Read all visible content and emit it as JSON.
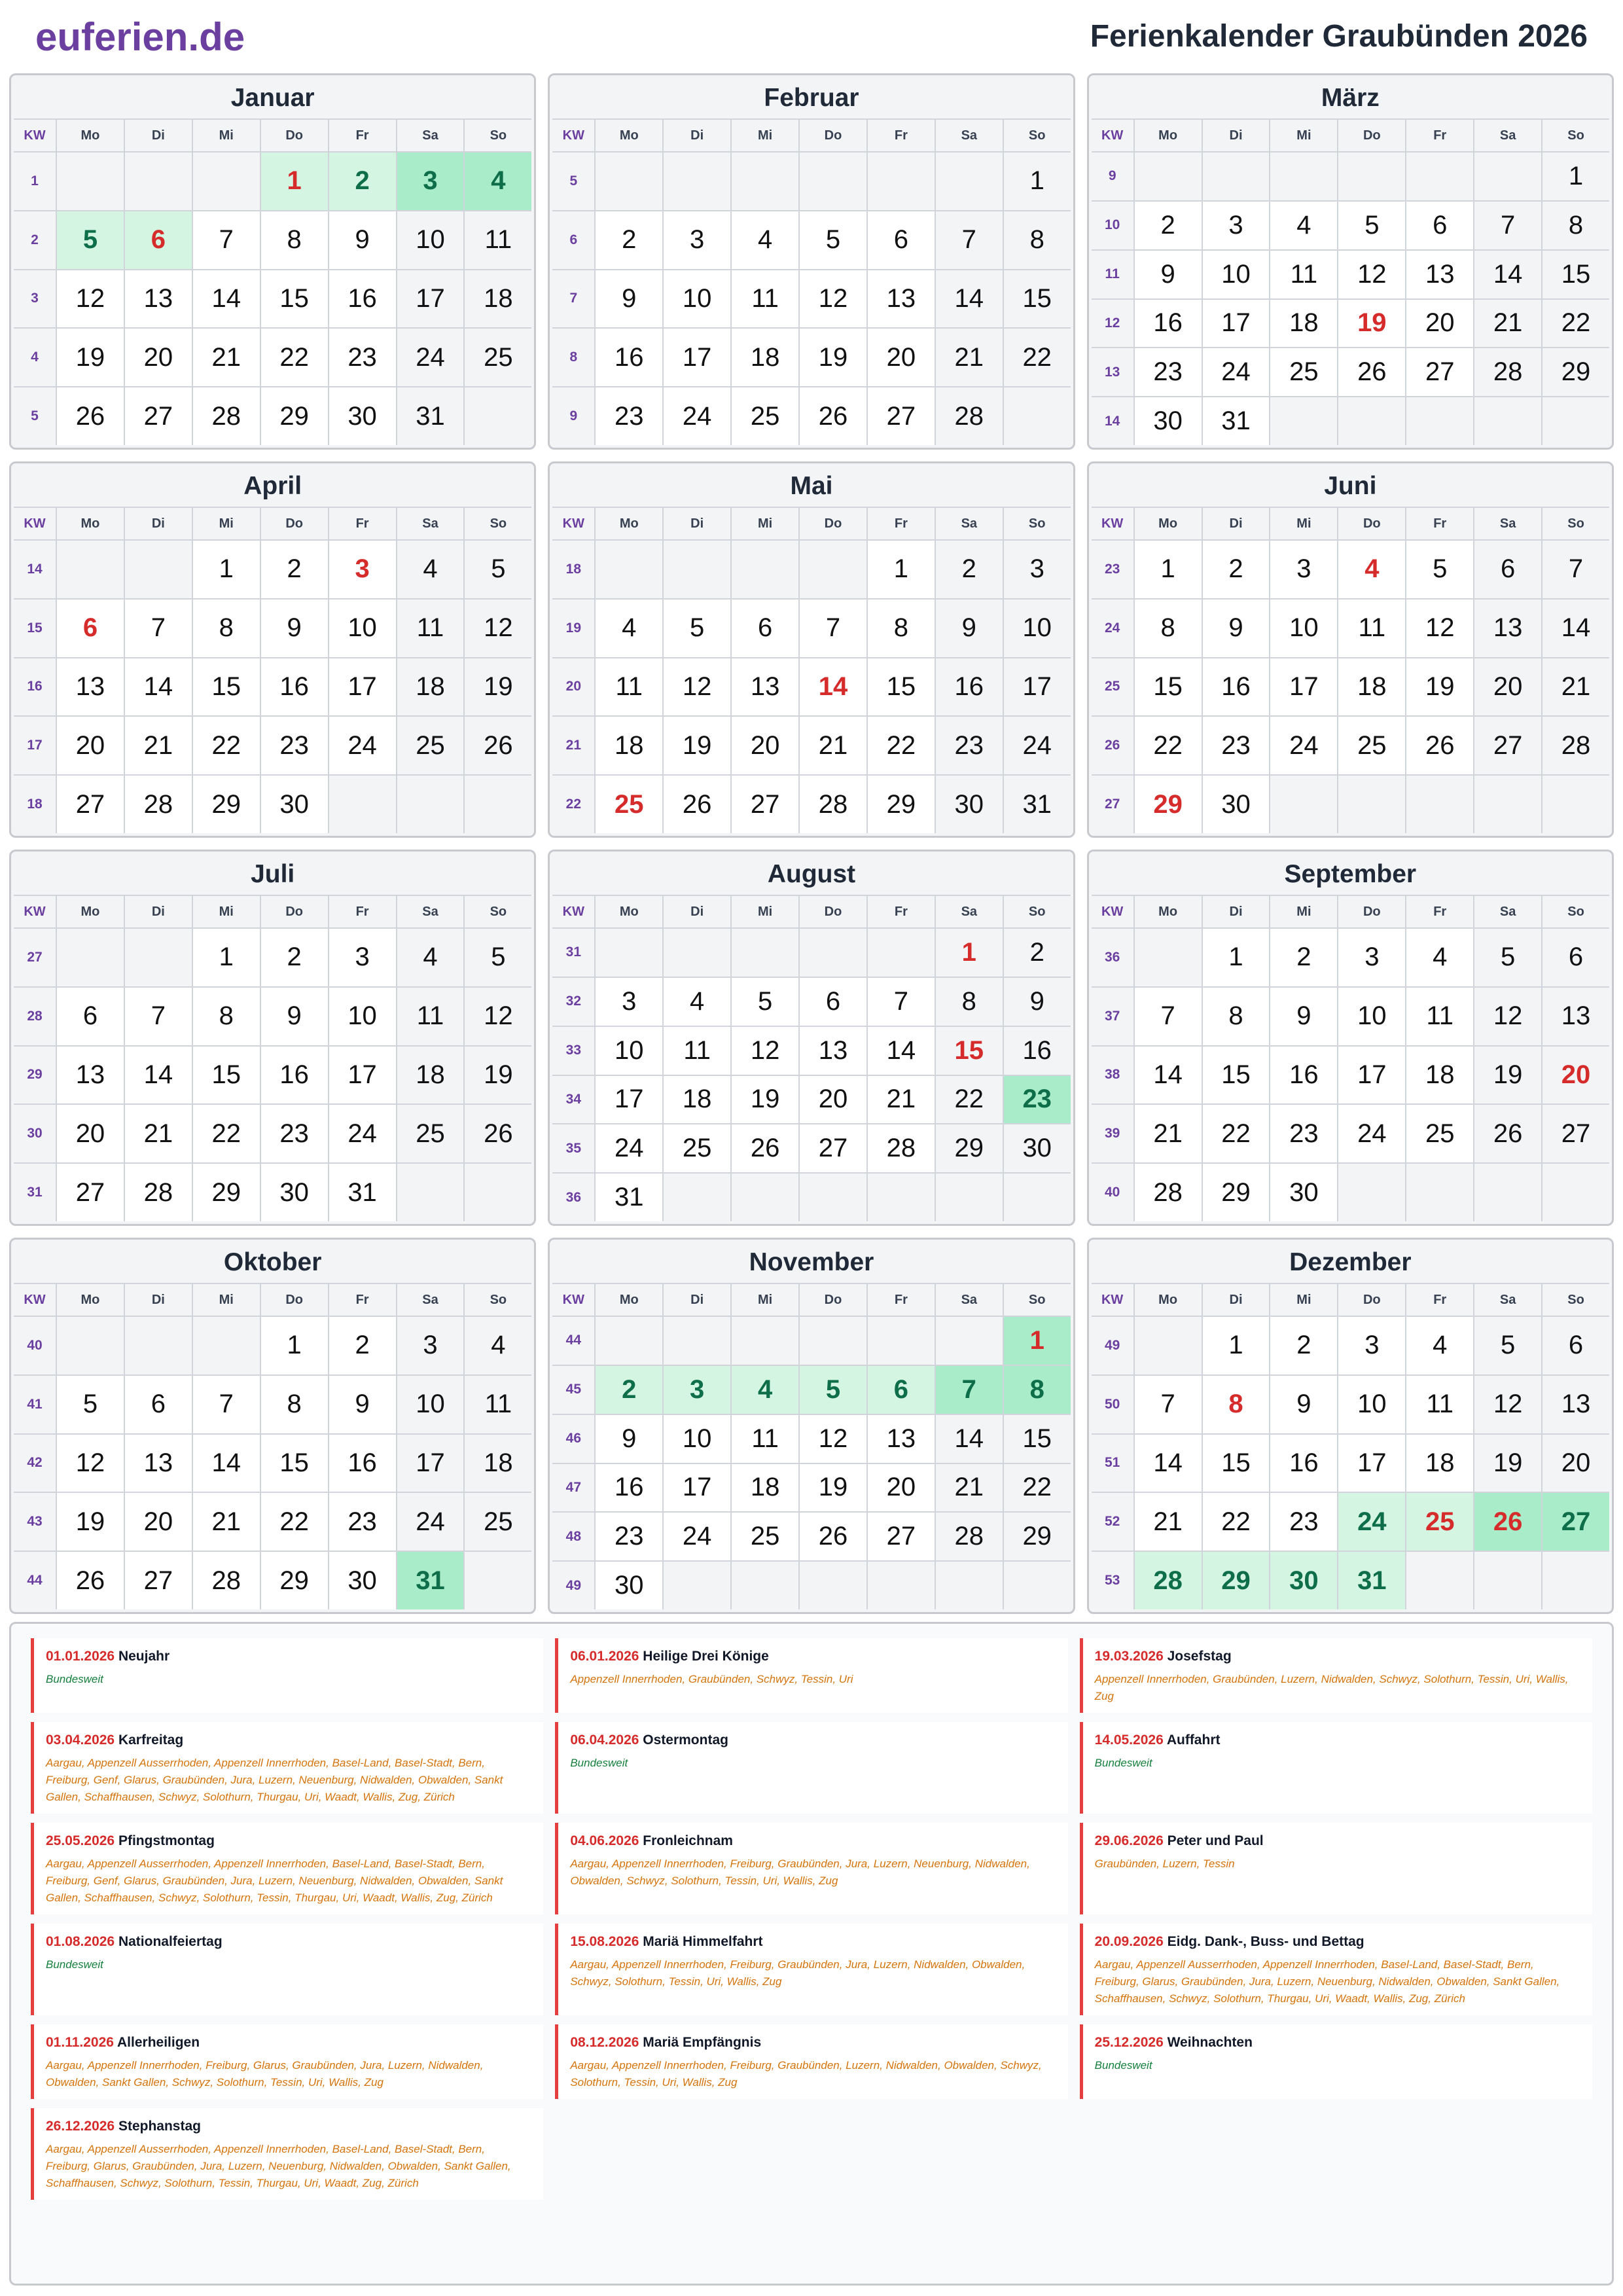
{
  "header": {
    "logo": "euferien.de",
    "title": "Ferienkalender Graubünden 2026"
  },
  "weekday_headers": [
    "KW",
    "Mo",
    "Di",
    "Mi",
    "Do",
    "Fr",
    "Sa",
    "So"
  ],
  "months": [
    {
      "name": "Januar",
      "start": 3,
      "days": 31,
      "kw": [
        "1",
        "2",
        "3",
        "4",
        "5"
      ],
      "hol": [
        1,
        6
      ],
      "vac": [
        1,
        2,
        3,
        4,
        5,
        6
      ]
    },
    {
      "name": "Februar",
      "start": 6,
      "days": 28,
      "kw": [
        "5",
        "6",
        "7",
        "8",
        "9"
      ],
      "hol": [],
      "vac": []
    },
    {
      "name": "März",
      "start": 6,
      "days": 31,
      "kw": [
        "9",
        "10",
        "11",
        "12",
        "13",
        "14"
      ],
      "hol": [
        19
      ],
      "vac": []
    },
    {
      "name": "April",
      "start": 2,
      "days": 30,
      "kw": [
        "14",
        "15",
        "16",
        "17",
        "18"
      ],
      "hol": [
        3,
        6
      ],
      "vac": []
    },
    {
      "name": "Mai",
      "start": 4,
      "days": 31,
      "kw": [
        "18",
        "19",
        "20",
        "21",
        "22"
      ],
      "hol": [
        14,
        25
      ],
      "vac": []
    },
    {
      "name": "Juni",
      "start": 0,
      "days": 30,
      "kw": [
        "23",
        "24",
        "25",
        "26",
        "27"
      ],
      "hol": [
        4,
        29
      ],
      "vac": []
    },
    {
      "name": "Juli",
      "start": 2,
      "days": 31,
      "kw": [
        "27",
        "28",
        "29",
        "30",
        "31"
      ],
      "hol": [],
      "vac": []
    },
    {
      "name": "August",
      "start": 5,
      "days": 31,
      "kw": [
        "31",
        "32",
        "33",
        "34",
        "35",
        "36"
      ],
      "hol": [
        1,
        15
      ],
      "vac": [
        23
      ]
    },
    {
      "name": "September",
      "start": 1,
      "days": 30,
      "kw": [
        "36",
        "37",
        "38",
        "39",
        "40"
      ],
      "hol": [
        20
      ],
      "vac": []
    },
    {
      "name": "Oktober",
      "start": 3,
      "days": 31,
      "kw": [
        "40",
        "41",
        "42",
        "43",
        "44"
      ],
      "hol": [],
      "vac": [
        31
      ]
    },
    {
      "name": "November",
      "start": 6,
      "days": 30,
      "kw": [
        "44",
        "45",
        "46",
        "47",
        "48",
        "49"
      ],
      "hol": [
        1
      ],
      "vac": [
        1,
        2,
        3,
        4,
        5,
        6,
        7,
        8
      ]
    },
    {
      "name": "Dezember",
      "start": 1,
      "days": 31,
      "kw": [
        "49",
        "50",
        "51",
        "52",
        "53"
      ],
      "hol": [
        8,
        25,
        26
      ],
      "vac": [
        24,
        25,
        26,
        27,
        28,
        29,
        30,
        31
      ]
    }
  ],
  "holidays": [
    {
      "date": "01.01.2026",
      "name": "Neujahr",
      "regions": "Bundesweit"
    },
    {
      "date": "06.01.2026",
      "name": "Heilige Drei Könige",
      "regions": "Appenzell Innerrhoden, Graubünden, Schwyz, Tessin, Uri"
    },
    {
      "date": "19.03.2026",
      "name": "Josefstag",
      "regions": "Appenzell Innerrhoden, Graubünden, Luzern, Nidwalden, Schwyz, Solothurn, Tessin, Uri, Wallis, Zug"
    },
    {
      "date": "03.04.2026",
      "name": "Karfreitag",
      "regions": "Aargau, Appenzell Ausserrhoden, Appenzell Innerrhoden, Basel-Land, Basel-Stadt, Bern, Freiburg, Genf, Glarus, Graubünden, Jura, Luzern, Neuenburg, Nidwalden, Obwalden, Sankt Gallen, Schaffhausen, Schwyz, Solothurn, Thurgau, Uri, Waadt, Wallis, Zug, Zürich"
    },
    {
      "date": "06.04.2026",
      "name": "Ostermontag",
      "regions": "Bundesweit"
    },
    {
      "date": "14.05.2026",
      "name": "Auffahrt",
      "regions": "Bundesweit"
    },
    {
      "date": "25.05.2026",
      "name": "Pfingstmontag",
      "regions": "Aargau, Appenzell Ausserrhoden, Appenzell Innerrhoden, Basel-Land, Basel-Stadt, Bern, Freiburg, Genf, Glarus, Graubünden, Jura, Luzern, Neuenburg, Nidwalden, Obwalden, Sankt Gallen, Schaffhausen, Schwyz, Solothurn, Tessin, Thurgau, Uri, Waadt, Wallis, Zug, Zürich"
    },
    {
      "date": "04.06.2026",
      "name": "Fronleichnam",
      "regions": "Aargau, Appenzell Innerrhoden, Freiburg, Graubünden, Jura, Luzern, Neuenburg, Nidwalden, Obwalden, Schwyz, Solothurn, Tessin, Uri, Wallis, Zug"
    },
    {
      "date": "29.06.2026",
      "name": "Peter und Paul",
      "regions": "Graubünden, Luzern, Tessin"
    },
    {
      "date": "01.08.2026",
      "name": "Nationalfeiertag",
      "regions": "Bundesweit"
    },
    {
      "date": "15.08.2026",
      "name": "Mariä Himmelfahrt",
      "regions": "Aargau, Appenzell Innerrhoden, Freiburg, Graubünden, Jura, Luzern, Nidwalden, Obwalden, Schwyz, Solothurn, Tessin, Uri, Wallis, Zug"
    },
    {
      "date": "20.09.2026",
      "name": "Eidg. Dank-, Buss- und Bettag",
      "regions": "Aargau, Appenzell Ausserrhoden, Appenzell Innerrhoden, Basel-Land, Basel-Stadt, Bern, Freiburg, Glarus, Graubünden, Jura, Luzern, Neuenburg, Nidwalden, Obwalden, Sankt Gallen, Schaffhausen, Schwyz, Solothurn, Thurgau, Uri, Waadt, Wallis, Zug, Zürich"
    },
    {
      "date": "01.11.2026",
      "name": "Allerheiligen",
      "regions": "Aargau, Appenzell Innerrhoden, Freiburg, Glarus, Graubünden, Jura, Luzern, Nidwalden, Obwalden, Sankt Gallen, Schwyz, Solothurn, Tessin, Uri, Wallis, Zug"
    },
    {
      "date": "08.12.2026",
      "name": "Mariä Empfängnis",
      "regions": "Aargau, Appenzell Innerrhoden, Freiburg, Graubünden, Luzern, Nidwalden, Obwalden, Schwyz, Solothurn, Tessin, Uri, Wallis, Zug"
    },
    {
      "date": "25.12.2026",
      "name": "Weihnachten",
      "regions": "Bundesweit"
    },
    {
      "date": "26.12.2026",
      "name": "Stephanstag",
      "regions": "Aargau, Appenzell Ausserrhoden, Appenzell Innerrhoden, Basel-Land, Basel-Stadt, Bern, Freiburg, Glarus, Graubünden, Jura, Luzern, Neuenburg, Nidwalden, Obwalden, Sankt Gallen, Schaffhausen, Schwyz, Solothurn, Tessin, Thurgau, Uri, Waadt, Zug, Zürich"
    }
  ],
  "colors": {
    "brand": "#6b3fa0",
    "holiday": "#d62b2b",
    "vacation": "#d5f5e3",
    "vacation_weekend": "#a8ecc9"
  }
}
